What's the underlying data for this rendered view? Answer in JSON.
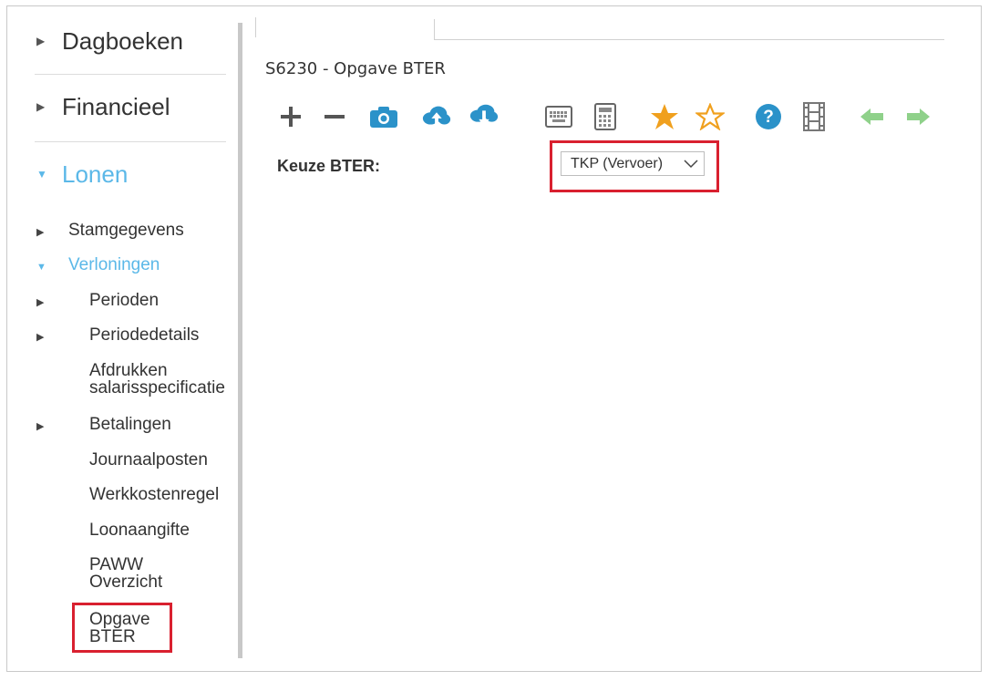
{
  "sidebar": {
    "main_items": [
      {
        "label": "Dagboeken",
        "expanded": false
      },
      {
        "label": "Financieel",
        "expanded": false
      },
      {
        "label": "Lonen",
        "expanded": true
      }
    ],
    "sub_items": [
      {
        "label": "Stamgegevens",
        "has_caret": true
      },
      {
        "label": "Verloningen",
        "has_caret": true,
        "expanded": true
      },
      {
        "label": "Perioden",
        "has_caret": true
      },
      {
        "label": "Periodedetails",
        "has_caret": true
      },
      {
        "label": "Afdrukken\nsalarisspecificatie",
        "has_caret": false
      },
      {
        "label": "Betalingen",
        "has_caret": true
      },
      {
        "label": "Journaalposten",
        "has_caret": false
      },
      {
        "label": "Werkkostenregel",
        "has_caret": false
      },
      {
        "label": "Loonaangifte",
        "has_caret": false
      },
      {
        "label": "PAWW\nOverzicht",
        "has_caret": false
      },
      {
        "label": "Opgave\nBTER",
        "has_caret": false,
        "selected": true
      }
    ]
  },
  "main": {
    "title": "S6230 - Opgave BTER",
    "toolbar_icons": [
      "plus-icon",
      "minus-icon",
      "camera-icon",
      "cloud-upload-icon",
      "cloud-download-icon",
      "keyboard-icon",
      "calculator-icon",
      "star-filled-icon",
      "star-outline-icon",
      "help-icon",
      "film-icon",
      "arrow-left-icon",
      "arrow-right-icon"
    ],
    "field_label": "Keuze BTER:",
    "select_value": "TKP (Vervoer)"
  },
  "colors": {
    "accent_blue": "#5bb8e8",
    "toolbar_blue": "#2b92c9",
    "star_orange": "#f0a01e",
    "arrow_green": "#8fd18a",
    "highlight_red": "#d9202f"
  }
}
